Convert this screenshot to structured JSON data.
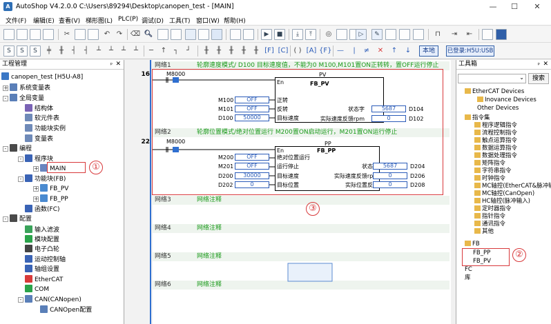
{
  "app_title": "AutoShop V4.2.0.0  C:\\Users\\89294\\Desktop\\canopen_test - [MAIN]",
  "window_buttons": [
    "—",
    "☐",
    "✕"
  ],
  "menu": [
    "文件(F)",
    "编辑(E)",
    "查看(V)",
    "梯形图(L)",
    "PLC(P)",
    "调试(D)",
    "工具(T)",
    "窗口(W)",
    "帮助(H)"
  ],
  "toolbar2_buttons": {
    "local": "本地",
    "login": "已登录:H5U:USB"
  },
  "left_panel": {
    "title": "工程管理",
    "items": [
      "canopen_test [H5U-A8]",
      "系统变量表",
      "全局变量",
      "结构体",
      "软元件表",
      "功能块实例",
      "变量表",
      "编程",
      "程序块",
      "MAIN",
      "功能块(FB)",
      "FB_PV",
      "FB_PP",
      "函数(FC)",
      "配置",
      "输入滤波",
      "模块配置",
      "电子凸轮",
      "运动控制轴",
      "轴组设置",
      "EtherCAT",
      "COM",
      "CAN(CANopen)",
      "CANOpen配置"
    ]
  },
  "editor": {
    "rows": [
      "16",
      "22"
    ],
    "networks": [
      {
        "label": "网络1",
        "comment": "轮廓速度模式/ D100 目标速度值，不能为0    M100,M101置ON正转转，置OFF运行停止"
      },
      {
        "label": "网络2",
        "comment": "轮廓位置模式/绝对位置运行  M200置ON启动运行，M201置ON运行停止"
      },
      {
        "label": "网络3",
        "comment": "网络注释"
      },
      {
        "label": "网络4",
        "comment": "网络注释"
      },
      {
        "label": "网络5",
        "comment": "网络注释"
      },
      {
        "label": "网络6",
        "comment": "网络注释"
      }
    ],
    "rung1": {
      "contact": "M8000",
      "instance": "PV",
      "fb_name": "FB_PV",
      "en": "En",
      "inputs": [
        {
          "var": "M100",
          "val": "OFF",
          "pin": "正转"
        },
        {
          "var": "M101",
          "val": "OFF",
          "pin": "反转"
        },
        {
          "var": "D100",
          "val": "50000",
          "pin": "目标速度"
        }
      ],
      "outputs": [
        {
          "pin": "状态字",
          "val": "5687",
          "var": "D104"
        },
        {
          "pin": "实际速度反馈rpm",
          "val": "0",
          "var": "D102"
        }
      ]
    },
    "rung2": {
      "contact": "M8000",
      "instance": "PP",
      "fb_name": "FB_PP",
      "en": "En",
      "inputs": [
        {
          "var": "M200",
          "val": "OFF",
          "pin": "绝对位置运行"
        },
        {
          "var": "M201",
          "val": "OFF",
          "pin": "运行停止"
        },
        {
          "var": "D200",
          "val": "30000",
          "pin": "目标速度"
        },
        {
          "var": "D202",
          "val": "0",
          "pin": "目标位置"
        }
      ],
      "outputs": [
        {
          "pin": "状态字",
          "val": "5687",
          "var": "D204"
        },
        {
          "pin": "实际速度反馈rpm",
          "val": "0",
          "var": "D206"
        },
        {
          "pin": "实际位置反馈",
          "val": "0",
          "var": "D208"
        }
      ]
    }
  },
  "right_panel": {
    "title": "工具箱",
    "search_button": "搜索",
    "items": [
      "EtherCAT Devices",
      "Inovance Devices",
      "Other Devices",
      "指令集",
      "程序逻辑指令",
      "流程控制指令",
      "触点运算指令",
      "数据运算指令",
      "数据处理指令",
      "矩阵指令",
      "字符串指令",
      "时钟指令",
      "MC轴控(EtherCAT&脉冲输)",
      "MC轴控(CanOpen)",
      "HC轴控(脉冲输入)",
      "定时器指令",
      "指针指令",
      "通讯指令",
      "其他",
      "FB",
      "FB_PP",
      "FB_PV",
      "FC",
      "库"
    ]
  },
  "annotations": [
    "①",
    "②",
    "③"
  ]
}
